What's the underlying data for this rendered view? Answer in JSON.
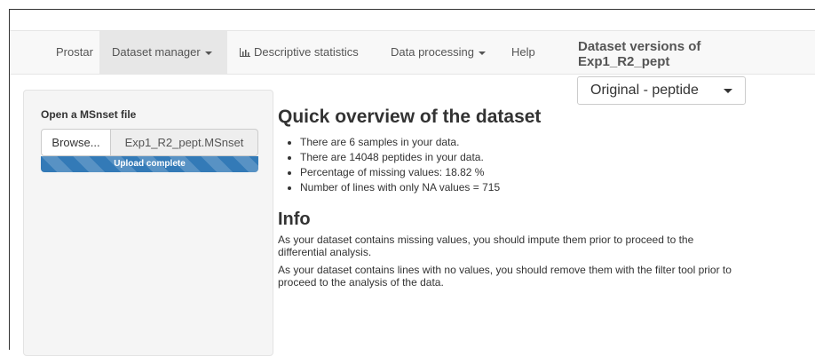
{
  "navbar": {
    "brand": "Prostar",
    "items": [
      {
        "label": "Dataset manager",
        "dropdown": true,
        "active": true
      },
      {
        "label": "Descriptive statistics",
        "icon": "bar-chart-icon"
      },
      {
        "label": "Data processing",
        "dropdown": true
      },
      {
        "label": "Help"
      }
    ],
    "dataset_versions_title": "Dataset versions of Exp1_R2_pept",
    "version_select": {
      "selected": "Original - peptide"
    }
  },
  "sidebar": {
    "label": "Open a MSnset file",
    "browse_label": "Browse...",
    "file_name": "Exp1_R2_pept.MSnset",
    "progress": {
      "text": "Upload complete",
      "percent": 100,
      "color": "#337ab7"
    }
  },
  "main": {
    "overview_title": "Quick overview of the dataset",
    "overview_items": [
      "There are 6 samples in your data.",
      "There are 14048 peptides in your data.",
      "Percentage of missing values: 18.82 %",
      "Number of lines with only NA values = 715"
    ],
    "info_title": "Info",
    "info_paragraphs": [
      "As your dataset contains missing values, you should impute them prior to proceed to the differential analysis.",
      "As your dataset contains lines with no values, you should remove them with the filter tool prior to proceed to the analysis of the data."
    ]
  }
}
